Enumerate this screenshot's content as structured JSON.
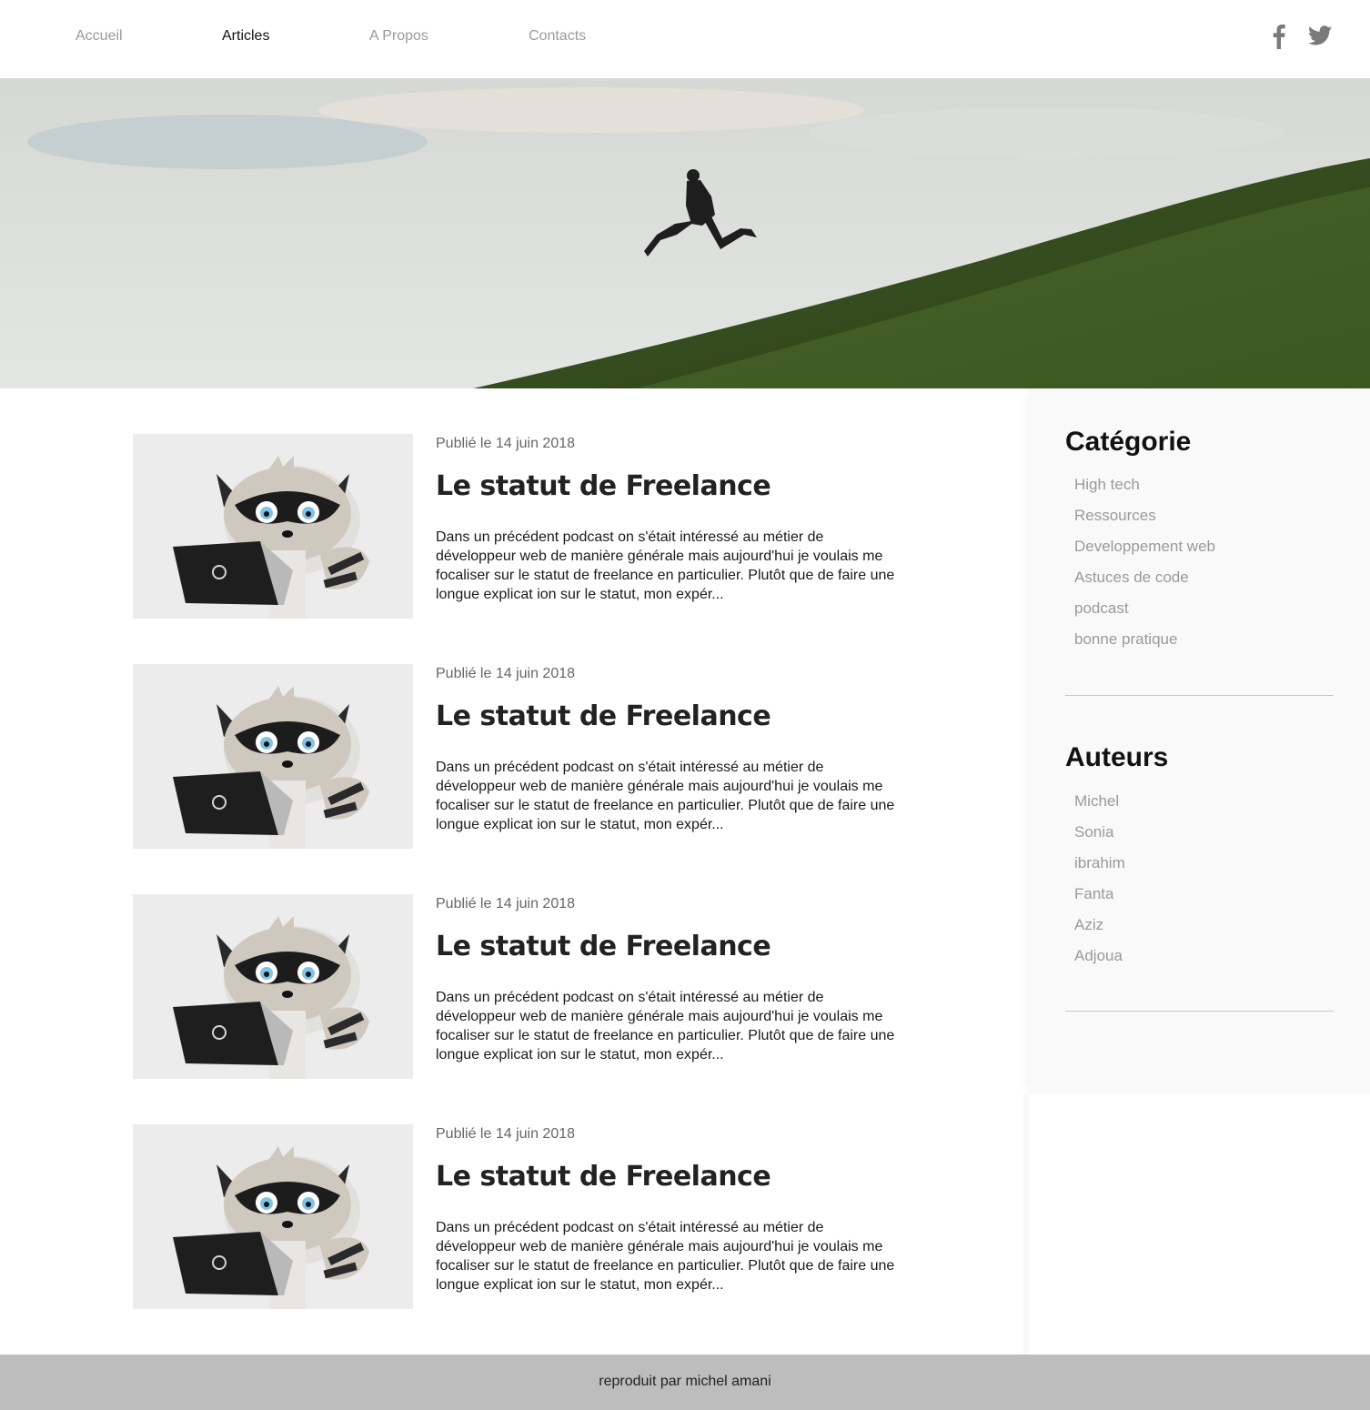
{
  "nav": {
    "items": [
      "Accueil",
      "Articles",
      "A Propos",
      "Contacts"
    ],
    "active": "Articles"
  },
  "social": {
    "facebook_icon": "facebook-icon",
    "twitter_icon": "twitter-icon"
  },
  "articles": [
    {
      "date": "Publié le 14 juin 2018",
      "title": "Le statut de Freelance",
      "excerpt": "Dans un précédent podcast on s'était intéressé au métier de développeur web de manière générale mais aujourd'hui je voulais me focaliser sur le statut de freelance en particulier. Plutôt que de faire une longue explicat ion sur le statut, mon expér..."
    },
    {
      "date": "Publié le 14 juin 2018",
      "title": "Le statut de Freelance",
      "excerpt": "Dans un précédent podcast on s'était intéressé au métier de développeur web de manière générale mais aujourd'hui je voulais me focaliser sur le statut de freelance en particulier. Plutôt que de faire une longue explicat ion sur le statut, mon expér..."
    },
    {
      "date": "Publié le 14 juin 2018",
      "title": "Le statut de Freelance",
      "excerpt": "Dans un précédent podcast on s'était intéressé au métier de développeur web de manière générale mais aujourd'hui je voulais me focaliser sur le statut de freelance en particulier. Plutôt que de faire une longue explicat ion sur le statut, mon expér..."
    },
    {
      "date": "Publié le 14 juin 2018",
      "title": "Le statut de Freelance",
      "excerpt": "Dans un précédent podcast on s'était intéressé au métier de développeur web de manière générale mais aujourd'hui je voulais me focaliser sur le statut de freelance en particulier. Plutôt que de faire une longue explicat ion sur le statut, mon expér..."
    }
  ],
  "sidebar": {
    "categories_title": "Catégorie",
    "categories": [
      "High tech",
      "Ressources",
      "Developpement web",
      "Astuces de code",
      "podcast",
      "bonne pratique"
    ],
    "authors_title": "Auteurs",
    "authors": [
      "Michel",
      "Sonia",
      "ibrahim",
      "Fanta",
      "Aziz",
      "Adjoua"
    ]
  },
  "footer": {
    "text": "reproduit par michel amani"
  },
  "colors": {
    "nav_inactive": "#9a9a9a",
    "nav_active": "#111111",
    "footer_bg": "#bdbdbd",
    "sidebar_bg": "#f9f9f9"
  }
}
